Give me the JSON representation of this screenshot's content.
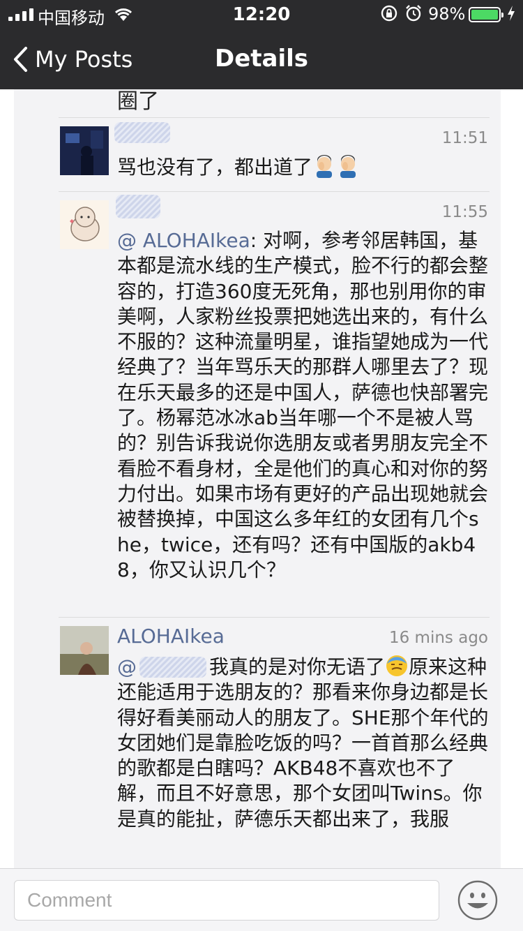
{
  "status_bar": {
    "carrier": "中国移动",
    "time": "12:20",
    "battery_percent": "98%",
    "signal_bars": 4,
    "battery_level": 0.98
  },
  "nav": {
    "back_label": "My Posts",
    "title": "Details"
  },
  "partial_text": "圈了",
  "comments": [
    {
      "time": "11:51",
      "text": "骂也没有了，都出道了"
    },
    {
      "time": "11:55",
      "mention": "@ ALOHAIkea",
      "text": ": 对啊，参考邻居韩国，基本都是流水线的生产模式，脸不行的都会整容的，打造360度无死角，那也别用你的审美啊，人家粉丝投票把她选出来的，有什么不服的？这种流量明星，谁指望她成为一代经典了？当年骂乐天的那群人哪里去了？现在乐天最多的还是中国人，萨德也快部署完了。杨幂范冰冰ab当年哪一个不是被人骂的？别告诉我说你选朋友或者男朋友完全不看脸不看身材，全是他们的真心和对你的努力付出。如果市场有更好的产品出现她就会被替换掉，中国这么多年红的女团有几个she，twice，还有吗？还有中国版的akb48，你又认识几个？"
    },
    {
      "name": "ALOHAIkea",
      "time": "16 mins ago",
      "mention": "@",
      "text_a": "我真的是对你无语了",
      "text_b": "原来这种还能适用于选朋友的？那看来你身边都是长得好看美丽动人的朋友了。SHE那个年代的女团她们是靠脸吃饭的吗？一首首那么经典的歌都是白瞎吗？AKB48不喜欢也不了解，而且不好意思，那个女团叫Twins。你是真的能扯，萨德乐天都出来了，我服"
    }
  ],
  "comment_bar": {
    "placeholder": "Comment"
  },
  "colors": {
    "header_bg": "#2b2b2d",
    "link_blue": "#576b95",
    "content_bg": "#f3f3f5",
    "battery_green": "#4cd964"
  },
  "icons": [
    "signal-icon",
    "wifi-icon",
    "rotation-lock-icon",
    "alarm-icon",
    "battery-icon",
    "charging-bolt-icon",
    "chevron-left-icon",
    "facepalm-emoji-icon",
    "sweat-emoji-icon",
    "smiley-icon"
  ]
}
